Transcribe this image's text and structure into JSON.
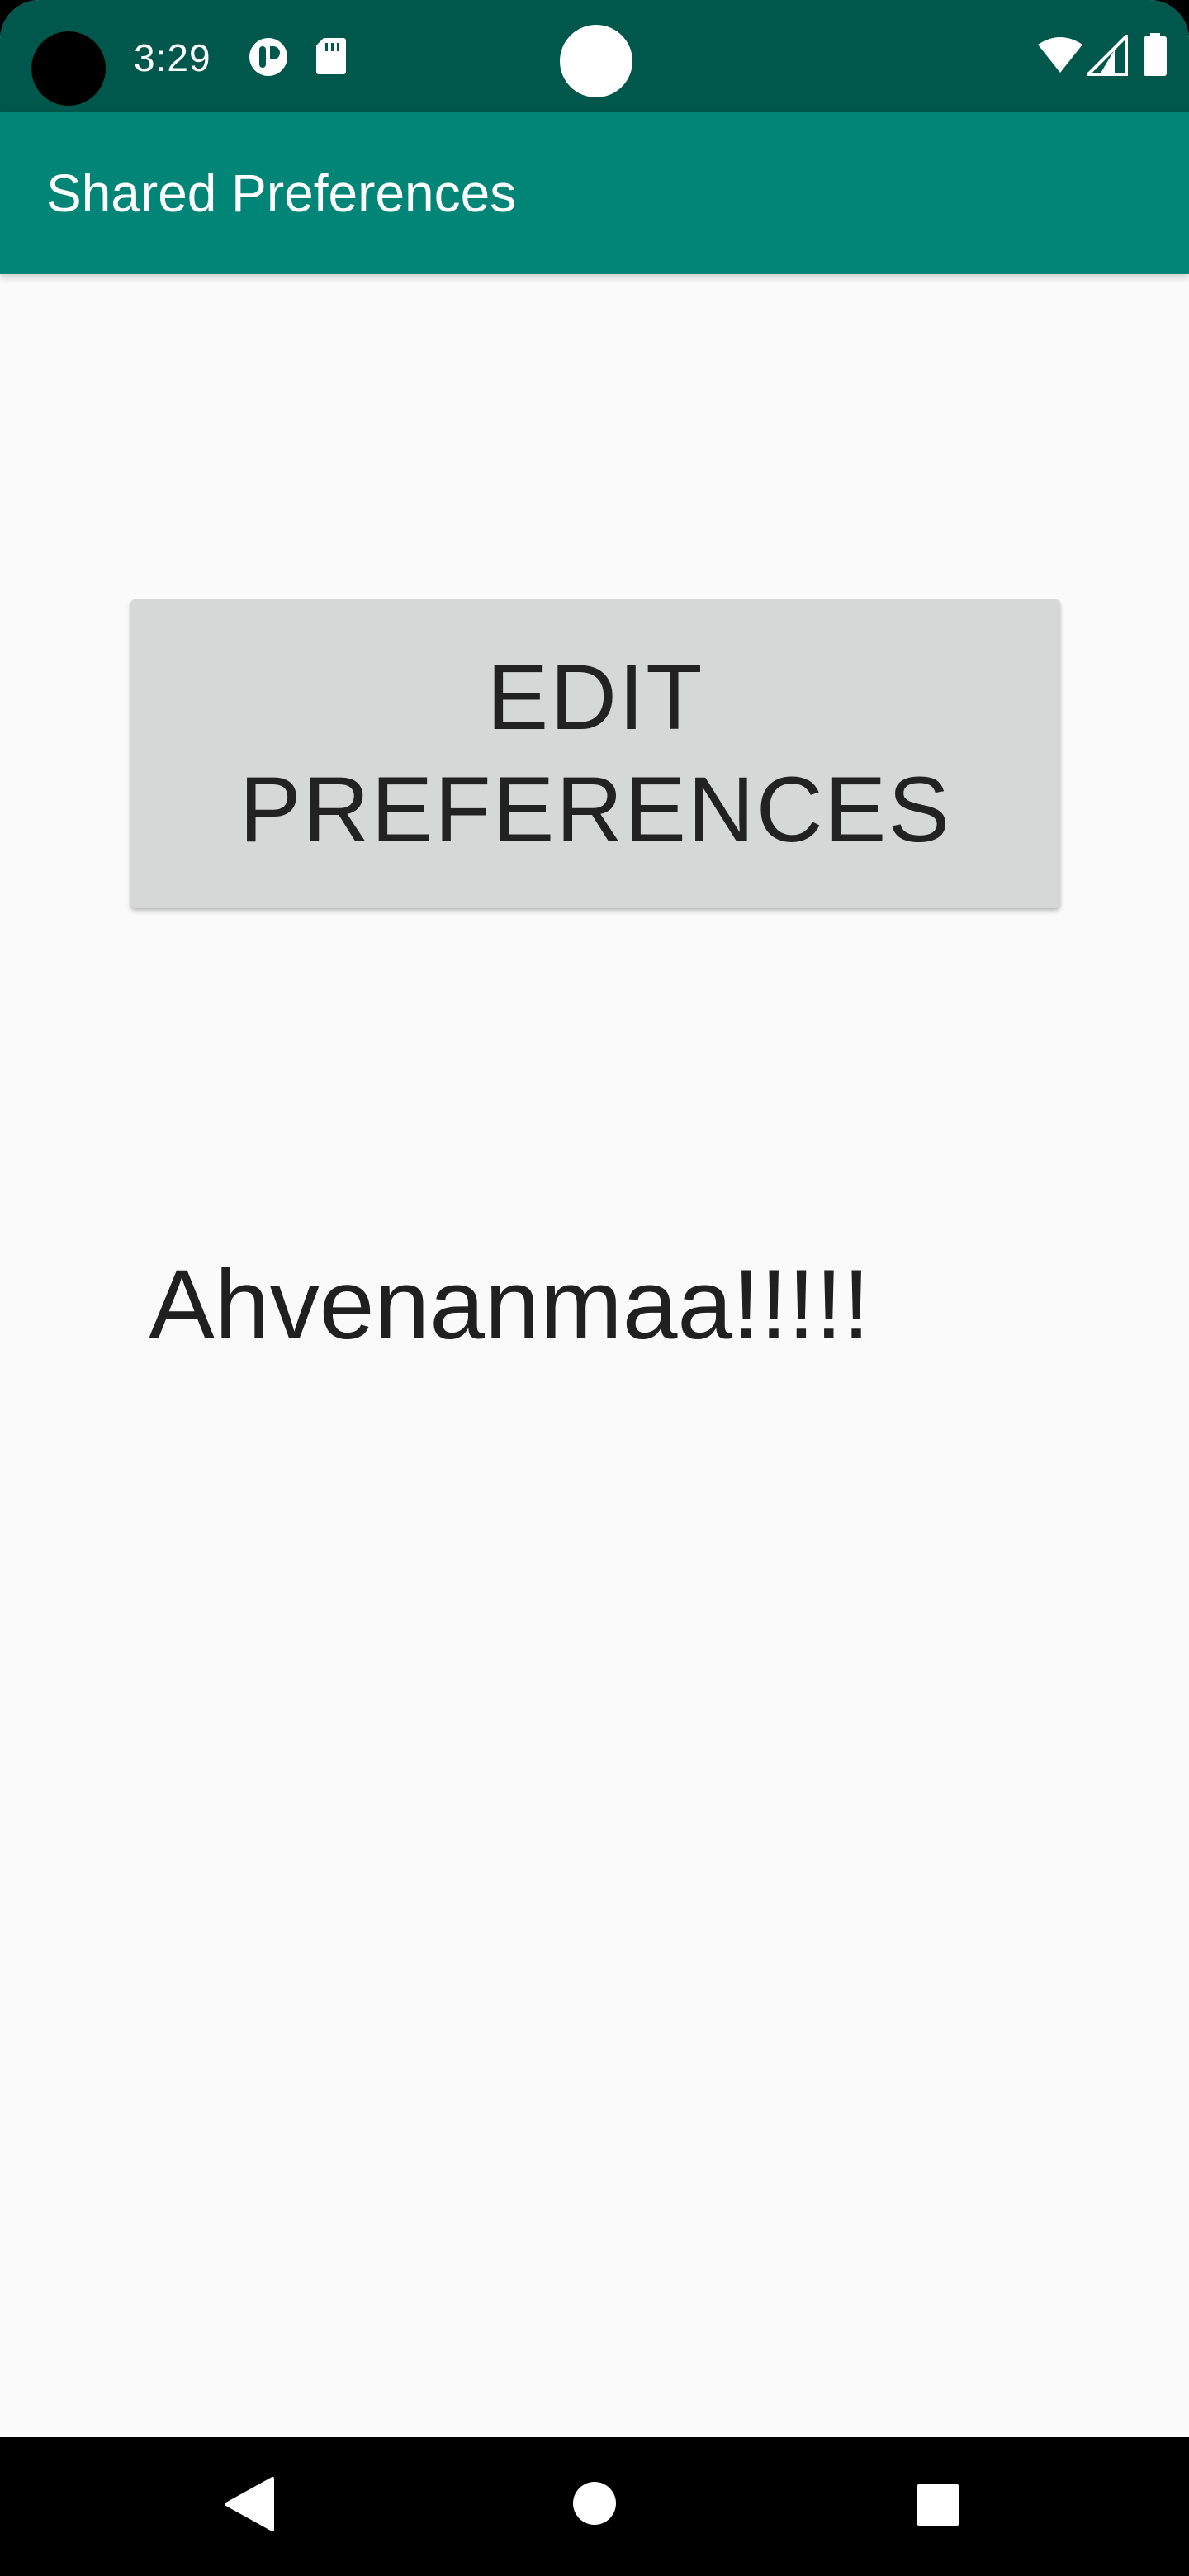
{
  "status_bar": {
    "time": "3:29",
    "icons": [
      "camera-hole",
      "notification-app-icon",
      "sd-card-icon",
      "wifi-icon",
      "cell-signal-icon",
      "battery-icon"
    ]
  },
  "app_bar": {
    "title": "Shared Preferences"
  },
  "main": {
    "edit_button_label": "EDIT PREFERENCES",
    "stored_value": "Ahvenanmaa!!!!!"
  },
  "nav_bar": {
    "buttons": [
      "back-icon",
      "home-icon",
      "recents-icon"
    ]
  },
  "colors": {
    "status_bar": "#00574b",
    "app_bar": "#008577",
    "background": "#fafafa",
    "button": "#d6d7d7"
  }
}
